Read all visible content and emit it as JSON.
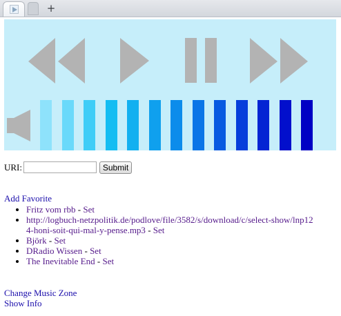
{
  "browser": {
    "new_tab_label": "+"
  },
  "player": {
    "background": "#c6eefa",
    "control_color": "#b3b3b3",
    "controls": [
      "rewind",
      "play",
      "pause",
      "fast-forward"
    ],
    "volume": {
      "bar_colors": [
        "#8ee2fb",
        "#6ad9fa",
        "#3fcdf7",
        "#14bdf2",
        "#12b0f0",
        "#0fa0ee",
        "#0c8ceb",
        "#0a75e7",
        "#075ae1",
        "#053edb",
        "#0424d3",
        "#020fcc",
        "#0000c4"
      ]
    }
  },
  "form": {
    "uri_label": "URI:",
    "uri_value": "",
    "submit_label": "Submit"
  },
  "favorites": {
    "add_label": "Add Favorite",
    "items": [
      {
        "name": "Fritz vom rbb",
        "action": "Set"
      },
      {
        "name": "http://logbuch-netzpolitik.de/podlove/file/3582/s/download/c/select-show/lnp124-honi-soit-qui-mal-y-pense.mp3",
        "action": "Set"
      },
      {
        "name": "Björk",
        "action": "Set"
      },
      {
        "name": "DRadio Wissen",
        "action": "Set"
      },
      {
        "name": "The Inevitable End",
        "action": "Set"
      }
    ],
    "separator": " - "
  },
  "footer": {
    "change_zone_label": "Change Music Zone",
    "show_info_label": "Show Info"
  }
}
